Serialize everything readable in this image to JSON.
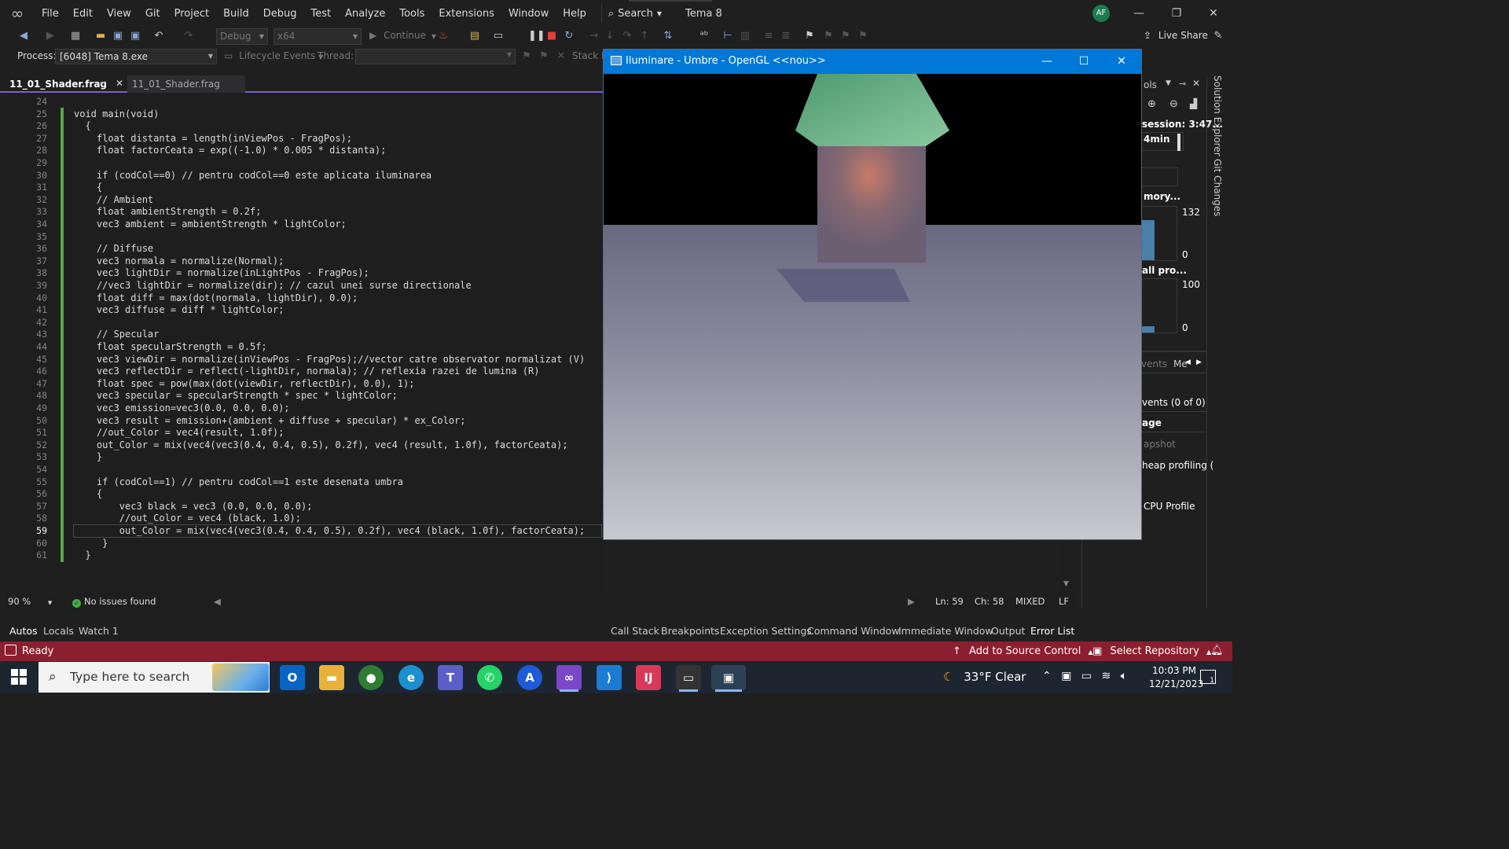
{
  "menu": {
    "items": [
      "File",
      "Edit",
      "View",
      "Git",
      "Project",
      "Build",
      "Debug",
      "Test",
      "Analyze",
      "Tools",
      "Extensions",
      "Window",
      "Help"
    ],
    "search_label": "Search",
    "solution_name": "Tema 8",
    "avatar_initials": "AF"
  },
  "toolbar": {
    "config_value": "Debug",
    "platform_value": "x64",
    "continue_label": "Continue",
    "live_share_label": "Live Share"
  },
  "process_bar": {
    "process_label": "Process:",
    "process_value": "[6048] Tema 8.exe",
    "lifecycle_label": "Lifecycle Events",
    "thread_label": "Thread:",
    "stackframe_label": "Stack F"
  },
  "tabs": [
    {
      "label": "11_01_Shader.frag",
      "active": true
    },
    {
      "label": "11_01_Shader.frag",
      "active": false
    }
  ],
  "editor": {
    "current_line": 59,
    "lines": [
      {
        "n": 24,
        "text": ""
      },
      {
        "n": 25,
        "text": "void main(void)"
      },
      {
        "n": 26,
        "text": "  {"
      },
      {
        "n": 27,
        "text": "    float distanta = length(inViewPos - FragPos);"
      },
      {
        "n": 28,
        "text": "    float factorCeata = exp((-1.0) * 0.005 * distanta);"
      },
      {
        "n": 29,
        "text": ""
      },
      {
        "n": 30,
        "text": "    if (codCol==0) // pentru codCol==0 este aplicata iluminarea"
      },
      {
        "n": 31,
        "text": "    {"
      },
      {
        "n": 32,
        "text": "    // Ambient"
      },
      {
        "n": 33,
        "text": "    float ambientStrength = 0.2f;"
      },
      {
        "n": 34,
        "text": "    vec3 ambient = ambientStrength * lightColor;"
      },
      {
        "n": 35,
        "text": ""
      },
      {
        "n": 36,
        "text": "    // Diffuse"
      },
      {
        "n": 37,
        "text": "    vec3 normala = normalize(Normal);"
      },
      {
        "n": 38,
        "text": "    vec3 lightDir = normalize(inLightPos - FragPos);"
      },
      {
        "n": 39,
        "text": "    //vec3 lightDir = normalize(dir); // cazul unei surse directionale"
      },
      {
        "n": 40,
        "text": "    float diff = max(dot(normala, lightDir), 0.0);"
      },
      {
        "n": 41,
        "text": "    vec3 diffuse = diff * lightColor;"
      },
      {
        "n": 42,
        "text": ""
      },
      {
        "n": 43,
        "text": "    // Specular"
      },
      {
        "n": 44,
        "text": "    float specularStrength = 0.5f;"
      },
      {
        "n": 45,
        "text": "    vec3 viewDir = normalize(inViewPos - FragPos);//vector catre observator normalizat (V)"
      },
      {
        "n": 46,
        "text": "    vec3 reflectDir = reflect(-lightDir, normala); // reflexia razei de lumina (R)"
      },
      {
        "n": 47,
        "text": "    float spec = pow(max(dot(viewDir, reflectDir), 0.0), 1);"
      },
      {
        "n": 48,
        "text": "    vec3 specular = specularStrength * spec * lightColor;"
      },
      {
        "n": 49,
        "text": "    vec3 emission=vec3(0.0, 0.0, 0.0);"
      },
      {
        "n": 50,
        "text": "    vec3 result = emission+(ambient + diffuse + specular) * ex_Color;"
      },
      {
        "n": 51,
        "text": "    //out_Color = vec4(result, 1.0f);"
      },
      {
        "n": 52,
        "text": "    out_Color = mix(vec4(vec3(0.4, 0.4, 0.5), 0.2f), vec4 (result, 1.0f), factorCeata);"
      },
      {
        "n": 53,
        "text": "    }"
      },
      {
        "n": 54,
        "text": ""
      },
      {
        "n": 55,
        "text": "    if (codCol==1) // pentru codCol==1 este desenata umbra"
      },
      {
        "n": 56,
        "text": "    {"
      },
      {
        "n": 57,
        "text": "        vec3 black = vec3 (0.0, 0.0, 0.0);"
      },
      {
        "n": 58,
        "text": "        //out_Color = vec4 (black, 1.0);"
      },
      {
        "n": 59,
        "text": "        out_Color = mix(vec4(vec3(0.4, 0.4, 0.5), 0.2f), vec4 (black, 1.0f), factorCeata);"
      },
      {
        "n": 60,
        "text": "     }"
      },
      {
        "n": 61,
        "text": "  }"
      }
    ]
  },
  "editor_status": {
    "zoom": "90 %",
    "issues": "No issues found",
    "line": "Ln: 59",
    "col": "Ch: 58",
    "tabs_mode": "MIXED",
    "eol": "LF"
  },
  "bottom_tabs": {
    "left": [
      "Autos",
      "Locals",
      "Watch 1"
    ],
    "right": [
      "Call Stack",
      "Breakpoints",
      "Exception Settings",
      "Command Window",
      "Immediate Window",
      "Output",
      "Error List"
    ]
  },
  "statusbar": {
    "ready": "Ready",
    "add_source": "Add to Source Control",
    "select_repo": "Select Repository"
  },
  "diag": {
    "session": "session: 3:47...",
    "timeline": "4min",
    "memory": "mory...",
    "mem_max": "132",
    "mem_min": "0",
    "cpu": "all pro...",
    "cpu_max": "100",
    "cpu_min": "0",
    "tab_events": "vents",
    "tab_me": "Me",
    "events": "vents (0 of 0)",
    "usage": "age",
    "snapshot": "apshot",
    "heap": "heap profiling (",
    "cpu_profile": "CPU Profile",
    "vtab_solution": "Solution Explorer",
    "vtab_git": "Git Changes"
  },
  "gl_window": {
    "title": "Iluminare - Umbre - OpenGL <<nou>>"
  },
  "taskbar": {
    "search_placeholder": "Type here to search",
    "weather": "33°F  Clear",
    "time": "10:03 PM",
    "date": "12/21/2023",
    "notif_count": "1"
  },
  "colors": {
    "accent": "#7b5fd0",
    "statusbar": "#8c1f2f",
    "gl_titlebar": "#0078d7"
  }
}
